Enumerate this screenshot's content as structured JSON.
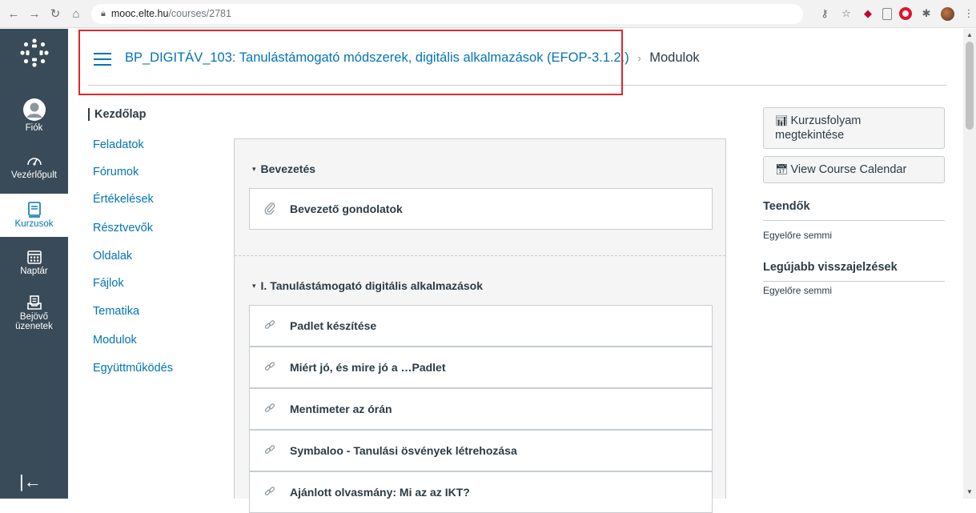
{
  "browser": {
    "host": "mooc.elte.hu",
    "path": "/courses/2781"
  },
  "global_nav": {
    "items": [
      {
        "label": "Fiók",
        "icon": "account-icon"
      },
      {
        "label": "Vezérlőpult",
        "icon": "dashboard-icon"
      },
      {
        "label": "Kurzusok",
        "icon": "courses-icon"
      },
      {
        "label": "Naptár",
        "icon": "calendar-icon"
      },
      {
        "label_line1": "Bejövő",
        "label_line2": "üzenetek",
        "icon": "inbox-icon"
      }
    ],
    "collapse_glyph": "|←"
  },
  "breadcrumb": {
    "course": "BP_DIGITÁV_103: Tanulástámogató módszerek, digitális alkalmazások (EFOP-3.1.2.)",
    "separator": "›",
    "current": "Modulok"
  },
  "course_nav": {
    "items": [
      "Kezdőlap",
      "Feladatok",
      "Fórumok",
      "Értékelések",
      "Résztvevők",
      "Oldalak",
      "Fájlok",
      "Tematika",
      "Modulok",
      "Együttműködés"
    ],
    "active_index": 0
  },
  "modules": [
    {
      "title": "Bevezetés",
      "items": [
        {
          "label": "Bevezető gondolatok",
          "icon": "attachment-icon"
        }
      ]
    },
    {
      "title": "I. Tanulástámogató digitális alkalmazások",
      "items": [
        {
          "label": "Padlet készítése",
          "icon": "link-icon"
        },
        {
          "label": "Miért jó, és mire jó a …Padlet",
          "icon": "link-icon"
        },
        {
          "label": "Mentimeter az órán",
          "icon": "link-icon"
        },
        {
          "label": "Symbaloo - Tanulási ösvények létrehozása",
          "icon": "link-icon"
        },
        {
          "label": "Ajánlott olvasmány: Mi az az IKT?",
          "icon": "link-icon"
        }
      ]
    }
  ],
  "sidebar": {
    "stream_button_line1": "Kurzusfolyam",
    "stream_button_line2": "megtekintése",
    "calendar_button": "View Course Calendar",
    "todo_heading": "Teendők",
    "todo_empty": "Egyelőre semmi",
    "feedback_heading": "Legújabb visszajelzések",
    "feedback_empty": "Egyelőre semmi"
  },
  "colors": {
    "global_nav_bg": "#394b58",
    "link": "#0374b5",
    "text": "#2d3b45",
    "annotation": "#e0262a"
  }
}
